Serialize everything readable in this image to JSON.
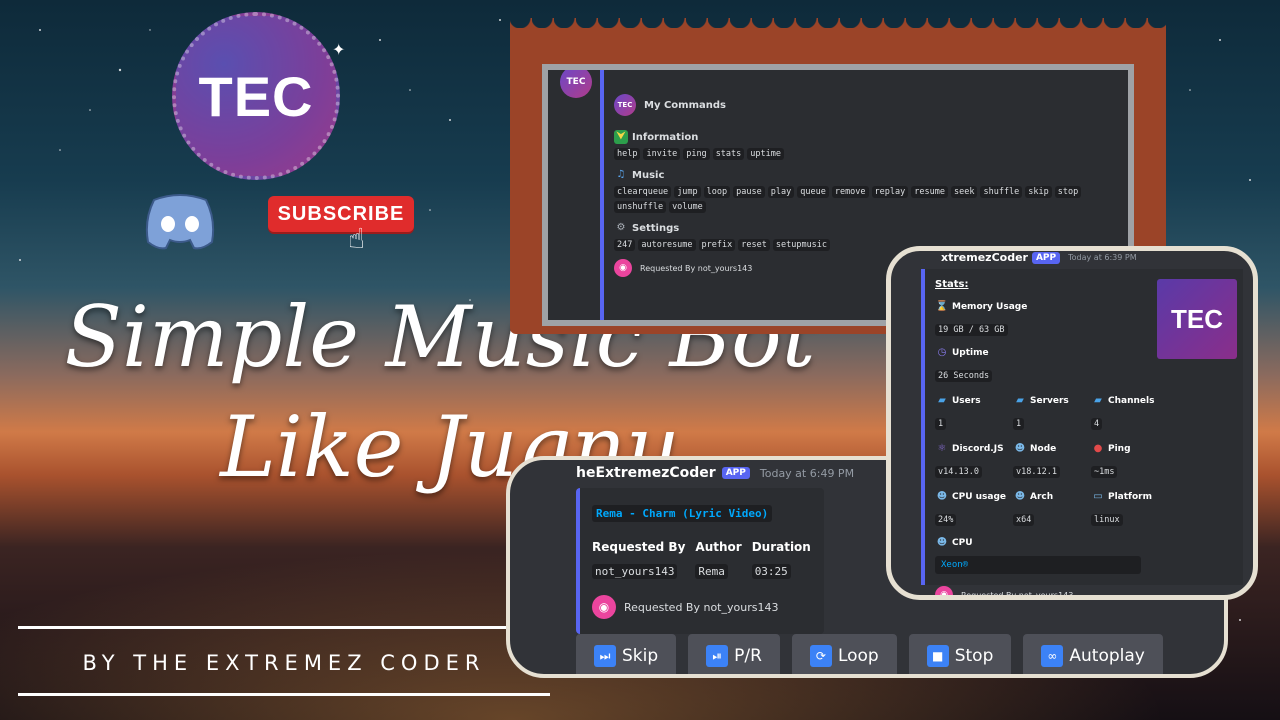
{
  "thumbnail": {
    "logo_text": "TEC",
    "subscribe_label": "SUBSCRIBE",
    "title_line1": "Simple Music Bot",
    "title_line2": "Like Jugnu",
    "byline": "BY THE EXTREMEZ CODER"
  },
  "commands_card": {
    "avatar_text": "TEC",
    "title": "My Commands",
    "sections": [
      {
        "icon": "beginner-icon",
        "title": "Information",
        "commands": [
          "help",
          "invite",
          "ping",
          "stats",
          "uptime"
        ]
      },
      {
        "icon": "music-note-icon",
        "title": "Music",
        "commands": [
          "clearqueue",
          "jump",
          "loop",
          "pause",
          "play",
          "queue",
          "remove",
          "replay",
          "resume",
          "seek",
          "shuffle",
          "skip",
          "stop",
          "unshuffle",
          "volume"
        ]
      },
      {
        "icon": "gear-icon",
        "title": "Settings",
        "commands": [
          "247",
          "autoresume",
          "prefix",
          "reset",
          "setupmusic"
        ]
      }
    ],
    "footer": "Requested By not_yours143"
  },
  "music_card": {
    "bot_name": "heExtremezCoder",
    "app_badge": "APP",
    "timestamp": "Today at 6:49 PM",
    "song": "Rema - Charm (Lyric Video)",
    "fields": [
      {
        "name": "Requested By",
        "value": "not_yours143"
      },
      {
        "name": "Author",
        "value": "Rema"
      },
      {
        "name": "Duration",
        "value": "03:25"
      }
    ],
    "footer": "Requested By not_yours143",
    "buttons": [
      {
        "icon": "skip-icon",
        "label": "Skip"
      },
      {
        "icon": "play-pause-icon",
        "label": "P/R"
      },
      {
        "icon": "loop-icon",
        "label": "Loop"
      },
      {
        "icon": "stop-icon",
        "label": "Stop"
      },
      {
        "icon": "infinity-icon",
        "label": "Autoplay"
      }
    ]
  },
  "stats_card": {
    "bot_name": "xtremezCoder",
    "app_badge": "APP",
    "timestamp": "Today at 6:39 PM",
    "title": "Stats:",
    "thumb_text": "TEC",
    "memory": {
      "name": "Memory Usage",
      "value": "19 GB / 63 GB"
    },
    "uptime": {
      "name": "Uptime",
      "value": "26 Seconds"
    },
    "row1": [
      {
        "name": "Users",
        "value": "1"
      },
      {
        "name": "Servers",
        "value": "1"
      },
      {
        "name": "Channels",
        "value": "4"
      }
    ],
    "row2": [
      {
        "name": "Discord.JS",
        "value": "v14.13.0"
      },
      {
        "name": "Node",
        "value": "v18.12.1"
      },
      {
        "name": "Ping",
        "value": "~1ms"
      }
    ],
    "row3": [
      {
        "name": "CPU usage",
        "value": "24%"
      },
      {
        "name": "Arch",
        "value": "x64"
      },
      {
        "name": "Platform",
        "value": "linux"
      }
    ],
    "cpu": {
      "name": "CPU",
      "value": "Xeon®"
    },
    "footer": "Requested By not_yours143"
  }
}
